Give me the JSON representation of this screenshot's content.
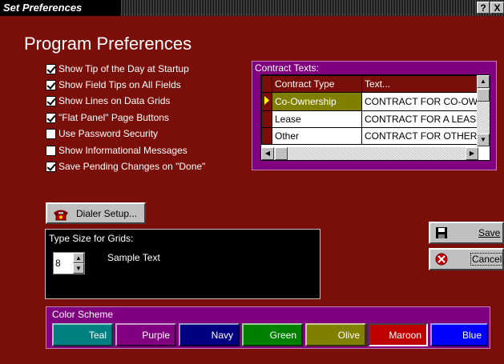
{
  "window": {
    "title": "Set Preferences",
    "help_label": "?",
    "close_label": "X"
  },
  "heading": "Program Preferences",
  "options": [
    {
      "label": "Show Tip of the Day at Startup",
      "checked": true
    },
    {
      "label": "Show Field Tips on All Fields",
      "checked": true
    },
    {
      "label": "Show Lines on Data Grids",
      "checked": true
    },
    {
      "label": "\"Flat Panel\" Page Buttons",
      "checked": true
    },
    {
      "label": "Use Password Security",
      "checked": false
    },
    {
      "label": "Show Informational Messages",
      "checked": false
    },
    {
      "label": "Save Pending Changes on \"Done\"",
      "checked": true
    }
  ],
  "contract_texts": {
    "label": "Contract Texts:",
    "columns": [
      "Contract Type",
      "Text..."
    ],
    "rows": [
      {
        "type": "Co-Ownership",
        "text": "CONTRACT FOR CO-OW",
        "selected": true
      },
      {
        "type": "Lease",
        "text": "CONTRACT FOR A LEAS",
        "selected": false
      },
      {
        "type": "Other",
        "text": "CONTRACT FOR OTHER",
        "selected": false
      }
    ]
  },
  "dialer_button": "Dialer Setup...",
  "type_size": {
    "label": "Type Size for Grids:",
    "value": "8",
    "sample": "Sample Text"
  },
  "actions": {
    "save": "Save",
    "cancel": "Cancel"
  },
  "color_scheme": {
    "label": "Color Scheme",
    "options": [
      {
        "name": "Teal",
        "color": "#008080",
        "selected": false
      },
      {
        "name": "Purple",
        "color": "#800080",
        "selected": false
      },
      {
        "name": "Navy",
        "color": "#000080",
        "selected": false
      },
      {
        "name": "Green",
        "color": "#008000",
        "selected": false
      },
      {
        "name": "Olive",
        "color": "#808000",
        "selected": false
      },
      {
        "name": "Maroon",
        "color": "#800000",
        "selected": true
      },
      {
        "name": "Blue",
        "color": "#0000ff",
        "selected": false
      }
    ]
  }
}
